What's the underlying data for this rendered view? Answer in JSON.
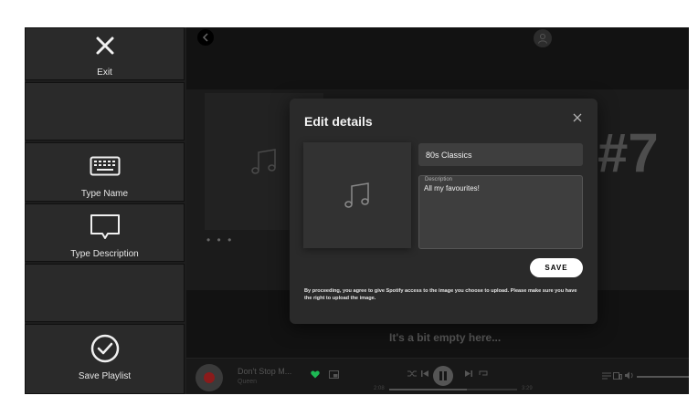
{
  "panel": {
    "exit_label": "Exit",
    "type_name_label": "Type Name",
    "type_description_label": "Type Description",
    "save_playlist_label": "Save Playlist"
  },
  "background": {
    "rank_text": "#7",
    "dots_text": "• • •",
    "empty_text": "It's a bit empty here..."
  },
  "player": {
    "track_title": "Don't Stop M...",
    "track_artist": "Queen",
    "time_current": "2:08",
    "time_total": "3:29",
    "progress_fraction": 0.61
  },
  "modal": {
    "title": "Edit details",
    "name_value": "80s Classics",
    "description_label": "Description",
    "description_value": "All my favourites!",
    "save_label": "SAVE",
    "disclaimer": "By proceeding, you agree to give Spotify access to the image you choose to upload. Please make sure you have the right to upload the image."
  },
  "colors": {
    "accent_green": "#1db954",
    "modal_bg": "#2a2a2a",
    "panel_tile": "#2a2a2a"
  },
  "icons": {
    "exit": "close-icon",
    "type_name": "keyboard-icon",
    "type_description": "speech-bubble-icon",
    "save_playlist": "check-circle-icon",
    "cover": "music-note-icon"
  }
}
